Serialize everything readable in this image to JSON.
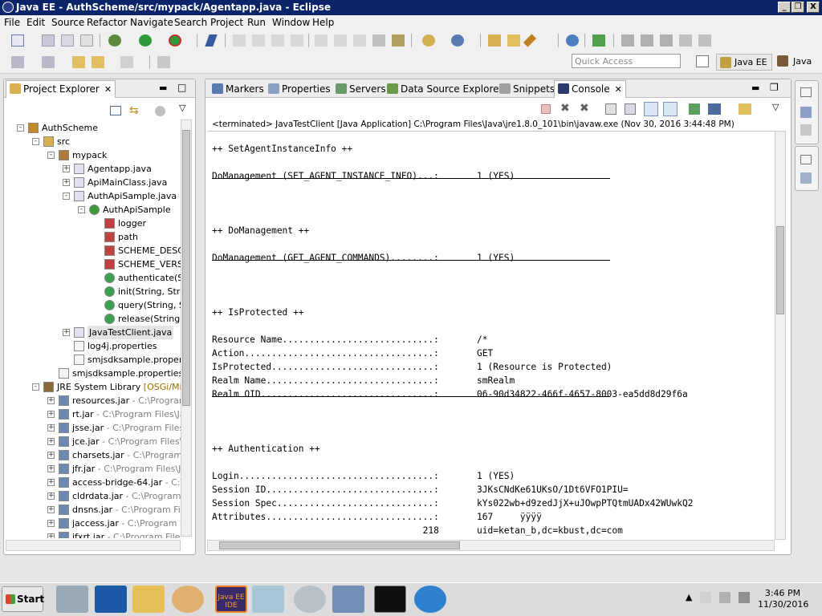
{
  "window": {
    "title": "Java EE - AuthScheme/src/mypack/Agentapp.java - Eclipse",
    "min": "_",
    "max": "❐",
    "close": "X"
  },
  "menu": [
    "File",
    "Edit",
    "Source",
    "Refactor",
    "Navigate",
    "Search",
    "Project",
    "Run",
    "Window",
    "Help"
  ],
  "quick_access": {
    "placeholder": "Quick Access"
  },
  "perspectives": {
    "java_ee": "Java EE",
    "java": "Java"
  },
  "project_explorer": {
    "title": "Project Explorer",
    "tree": [
      {
        "label": "AuthScheme",
        "suffix": "",
        "indent": 0,
        "exp": "-",
        "icon": "project-icon"
      },
      {
        "label": "src",
        "suffix": "",
        "indent": 1,
        "exp": "-",
        "icon": "src-folder-icon"
      },
      {
        "label": "mypack",
        "suffix": "",
        "indent": 2,
        "exp": "-",
        "icon": "package-icon"
      },
      {
        "label": "Agentapp.java",
        "suffix": "",
        "indent": 3,
        "exp": "+",
        "icon": "java-file-icon"
      },
      {
        "label": "ApiMainClass.java",
        "suffix": "",
        "indent": 3,
        "exp": "+",
        "icon": "java-file-icon"
      },
      {
        "label": "AuthApiSample.java",
        "suffix": "",
        "indent": 3,
        "exp": "-",
        "icon": "java-file-icon"
      },
      {
        "label": "AuthApiSample",
        "suffix": "",
        "indent": 4,
        "exp": "-",
        "icon": "class-icon"
      },
      {
        "label": "logger",
        "suffix": "",
        "indent": 5,
        "exp": "",
        "icon": "static-field-icon"
      },
      {
        "label": "path",
        "suffix": "",
        "indent": 5,
        "exp": "",
        "icon": "static-field-icon"
      },
      {
        "label": "SCHEME_DESC",
        "suffix": "",
        "indent": 5,
        "exp": "",
        "icon": "static-field-icon"
      },
      {
        "label": "SCHEME_VERSI",
        "suffix": "",
        "indent": 5,
        "exp": "",
        "icon": "static-field-icon"
      },
      {
        "label": "authenticate(S",
        "suffix": "",
        "indent": 5,
        "exp": "",
        "icon": "method-icon"
      },
      {
        "label": "init(String, Strin",
        "suffix": "",
        "indent": 5,
        "exp": "",
        "icon": "method-icon"
      },
      {
        "label": "query(String, S",
        "suffix": "",
        "indent": 5,
        "exp": "",
        "icon": "method-icon"
      },
      {
        "label": "release(String,",
        "suffix": "",
        "indent": 5,
        "exp": "",
        "icon": "method-icon"
      },
      {
        "label": "JavaTestClient.java",
        "suffix": "",
        "indent": 3,
        "exp": "+",
        "icon": "java-file-icon",
        "selected": true
      },
      {
        "label": "log4j.properties",
        "suffix": "",
        "indent": 3,
        "exp": "",
        "icon": "properties-file-icon"
      },
      {
        "label": "smjsdksample.properties",
        "suffix": "",
        "indent": 3,
        "exp": "",
        "icon": "properties-file-icon"
      },
      {
        "label": "smjsdksample.properties",
        "suffix": "",
        "indent": 2,
        "exp": "",
        "icon": "properties-file-icon"
      },
      {
        "label": "JRE System Library",
        "suffix": " [OSGi/Minim",
        "indent": 1,
        "exp": "-",
        "icon": "library-icon",
        "orange": true
      },
      {
        "label": "resources.jar",
        "suffix": " - C:\\Program",
        "indent": 2,
        "exp": "+",
        "icon": "jar-icon"
      },
      {
        "label": "rt.jar",
        "suffix": " - C:\\Program Files\\Ja",
        "indent": 2,
        "exp": "+",
        "icon": "jar-icon"
      },
      {
        "label": "jsse.jar",
        "suffix": " - C:\\Program Files\\",
        "indent": 2,
        "exp": "+",
        "icon": "jar-icon"
      },
      {
        "label": "jce.jar",
        "suffix": " - C:\\Program Files\\J",
        "indent": 2,
        "exp": "+",
        "icon": "jar-icon"
      },
      {
        "label": "charsets.jar",
        "suffix": " - C:\\Program F",
        "indent": 2,
        "exp": "+",
        "icon": "jar-icon"
      },
      {
        "label": "jfr.jar",
        "suffix": " - C:\\Program Files\\Ja",
        "indent": 2,
        "exp": "+",
        "icon": "jar-icon"
      },
      {
        "label": "access-bridge-64.jar",
        "suffix": " - C:\\P",
        "indent": 2,
        "exp": "+",
        "icon": "jar-icon"
      },
      {
        "label": "cldrdata.jar",
        "suffix": " - C:\\Program F",
        "indent": 2,
        "exp": "+",
        "icon": "jar-icon"
      },
      {
        "label": "dnsns.jar",
        "suffix": " - C:\\Program File",
        "indent": 2,
        "exp": "+",
        "icon": "jar-icon"
      },
      {
        "label": "jaccess.jar",
        "suffix": " - C:\\Program Fil",
        "indent": 2,
        "exp": "+",
        "icon": "jar-icon"
      },
      {
        "label": "jfxrt.jar",
        "suffix": " - C:\\Program Files\\",
        "indent": 2,
        "exp": "+",
        "icon": "jar-icon"
      }
    ]
  },
  "tabs": [
    {
      "label": "Markers",
      "icon": "markers-icon",
      "name": "tab-markers"
    },
    {
      "label": "Properties",
      "icon": "properties-icon",
      "name": "tab-properties"
    },
    {
      "label": "Servers",
      "icon": "servers-icon",
      "name": "tab-servers"
    },
    {
      "label": "Data Source Explorer",
      "icon": "data-source-icon",
      "name": "tab-data-source-explorer"
    },
    {
      "label": "Snippets",
      "icon": "snippets-icon",
      "name": "tab-snippets"
    },
    {
      "label": "Console",
      "icon": "console-icon",
      "name": "tab-console",
      "active": true
    }
  ],
  "console": {
    "status": "<terminated> JavaTestClient [Java Application] C:\\Program Files\\Java\\jre1.8.0_101\\bin\\javaw.exe (Nov 30, 2016 3:44:48 PM)",
    "lines": [
      {
        "t": "",
        "type": "text"
      },
      {
        "t": "++ SetAgentInstanceInfo ++",
        "type": "text"
      },
      {
        "t": "",
        "type": "text"
      },
      {
        "t": "DoManagement (SET_AGENT_INSTANCE_INFO)...:       1 (YES)",
        "type": "text"
      },
      {
        "t": "",
        "type": "hr"
      },
      {
        "t": "",
        "type": "text"
      },
      {
        "t": "",
        "type": "text"
      },
      {
        "t": "++ DoManagement ++",
        "type": "text"
      },
      {
        "t": "",
        "type": "text"
      },
      {
        "t": "DoManagement (GET_AGENT_COMMANDS)........:       1 (YES)",
        "type": "text"
      },
      {
        "t": "",
        "type": "hr"
      },
      {
        "t": "",
        "type": "text"
      },
      {
        "t": "",
        "type": "text"
      },
      {
        "t": "++ IsProtected ++",
        "type": "text"
      },
      {
        "t": "",
        "type": "text"
      },
      {
        "t": "Resource Name............................:       /*",
        "type": "text"
      },
      {
        "t": "Action...................................:       GET",
        "type": "text"
      },
      {
        "t": "IsProtected..............................:       1 (Resource is Protected)",
        "type": "text"
      },
      {
        "t": "Realm Name...............................:       smRealm",
        "type": "text"
      },
      {
        "t": "Realm OID................................:       06-90d34822-466f-4657-8003-ea5dd8d29f6a",
        "type": "text"
      },
      {
        "t": "",
        "type": "hr"
      },
      {
        "t": "",
        "type": "text"
      },
      {
        "t": "",
        "type": "text"
      },
      {
        "t": "++ Authentication ++",
        "type": "text"
      },
      {
        "t": "",
        "type": "text"
      },
      {
        "t": "Login....................................:       1 (YES)",
        "type": "text"
      },
      {
        "t": "Session ID...............................:       3JKsCNdKe61UKsO/1Dt6VFO1PIU=",
        "type": "text"
      },
      {
        "t": "Session Spec.............................:       kYs022wb+d9zedJjX+uJOwpPTQtmUADx42WUwkQ2",
        "type": "text"
      },
      {
        "t": "Attributes...............................:       167     ÿÿÿÿ",
        "type": "text"
      },
      {
        "t": "                                       218       uid=ketan_b,dc=kbust,dc=com",
        "type": "text"
      }
    ]
  },
  "taskbar": {
    "start": "Start",
    "time": "3:46 PM",
    "date": "11/30/2016",
    "ide_label": "Java EE IDE"
  }
}
